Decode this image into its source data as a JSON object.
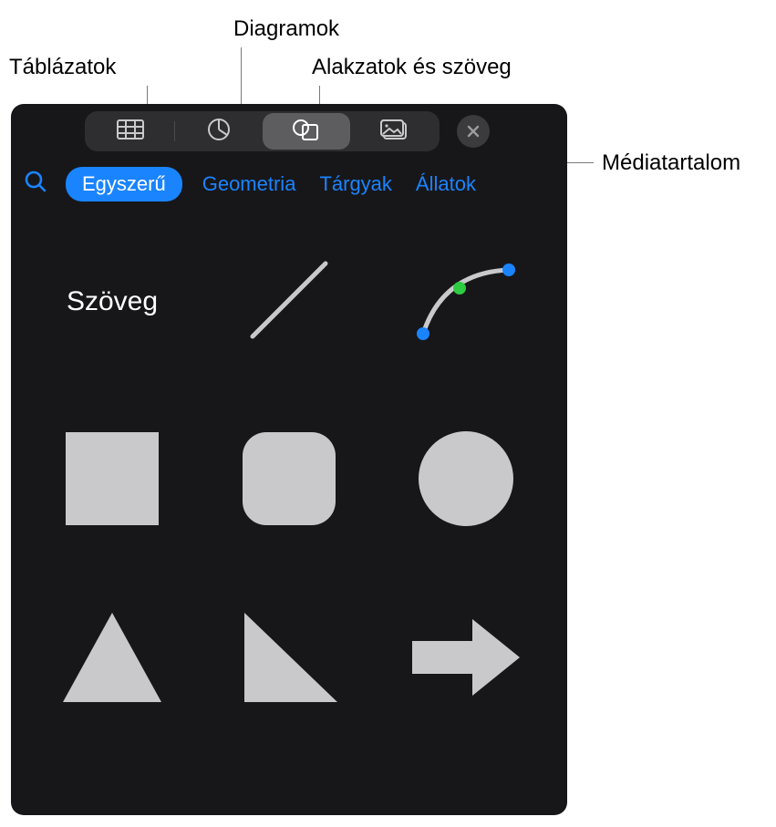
{
  "callouts": {
    "tables": "Táblázatok",
    "charts": "Diagramok",
    "shapes_text": "Alakzatok és szöveg",
    "media": "Médiatartalom"
  },
  "categories": {
    "selected": "Egyszerű",
    "items": [
      "Egyszerű",
      "Geometria",
      "Tárgyak",
      "Állatok"
    ]
  },
  "shapes": {
    "text_label": "Szöveg"
  }
}
